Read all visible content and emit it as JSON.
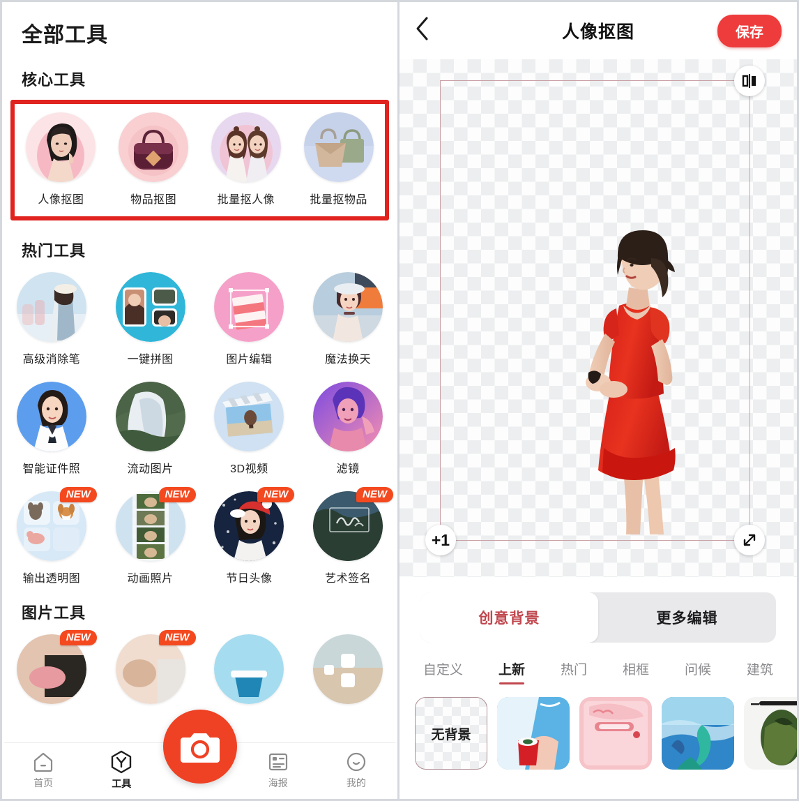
{
  "left": {
    "page_title": "全部工具",
    "sections": [
      {
        "id": "core",
        "title": "核心工具",
        "highlighted": true,
        "highlight_color": "#e0231e",
        "items": [
          {
            "label": "人像抠图",
            "icon": "portrait-cutout-icon",
            "badge": ""
          },
          {
            "label": "物品抠图",
            "icon": "object-cutout-icon",
            "badge": ""
          },
          {
            "label": "批量抠人像",
            "icon": "batch-portrait-cutout-icon",
            "badge": ""
          },
          {
            "label": "批量抠物品",
            "icon": "batch-object-cutout-icon",
            "badge": ""
          }
        ]
      },
      {
        "id": "hot",
        "title": "热门工具",
        "highlighted": false,
        "rows": [
          [
            {
              "label": "高级消除笔",
              "icon": "advanced-eraser-icon",
              "badge": ""
            },
            {
              "label": "一键拼图",
              "icon": "one-click-collage-icon",
              "badge": ""
            },
            {
              "label": "图片编辑",
              "icon": "photo-edit-icon",
              "badge": ""
            },
            {
              "label": "魔法换天",
              "icon": "magic-sky-icon",
              "badge": ""
            }
          ],
          [
            {
              "label": "智能证件照",
              "icon": "id-photo-icon",
              "badge": ""
            },
            {
              "label": "流动图片",
              "icon": "motion-photo-icon",
              "badge": ""
            },
            {
              "label": "3D视频",
              "icon": "3d-video-icon",
              "badge": ""
            },
            {
              "label": "滤镜",
              "icon": "filter-icon",
              "badge": ""
            }
          ],
          [
            {
              "label": "输出透明图",
              "icon": "transparent-output-icon",
              "badge": "NEW"
            },
            {
              "label": "动画照片",
              "icon": "animated-photo-icon",
              "badge": "NEW"
            },
            {
              "label": "节日头像",
              "icon": "holiday-avatar-icon",
              "badge": "NEW"
            },
            {
              "label": "艺术签名",
              "icon": "art-signature-icon",
              "badge": "NEW"
            }
          ]
        ]
      },
      {
        "id": "image",
        "title": "图片工具",
        "highlighted": false,
        "rows": [
          [
            {
              "label": "",
              "icon": "image-tool-1-icon",
              "badge": "NEW"
            },
            {
              "label": "",
              "icon": "image-tool-2-icon",
              "badge": "NEW"
            },
            {
              "label": "",
              "icon": "image-tool-3-icon",
              "badge": ""
            },
            {
              "label": "",
              "icon": "image-tool-4-icon",
              "badge": ""
            }
          ]
        ]
      }
    ],
    "bottom_nav": {
      "camera_icon": "camera-icon",
      "camera_color": "#ef4124",
      "items": [
        {
          "label": "首页",
          "icon": "home-icon",
          "active": false
        },
        {
          "label": "工具",
          "icon": "tools-icon",
          "active": true
        },
        {
          "label": "海报",
          "icon": "poster-icon",
          "active": false
        },
        {
          "label": "我的",
          "icon": "profile-icon",
          "active": false
        }
      ]
    }
  },
  "right": {
    "header": {
      "back_icon": "back-chevron-icon",
      "title": "人像抠图",
      "save_label": "保存",
      "save_color": "#ee3b3b"
    },
    "canvas": {
      "background": "transparent-checkerboard",
      "frame_color": "#c9a0a6",
      "handles": {
        "flip": "mirror-flip-icon",
        "add_count": "+1",
        "scale": "resize-diagonal-icon"
      },
      "subject_alt": "woman-in-red-dress-cutout"
    },
    "segmented_tabs": [
      {
        "label": "创意背景",
        "active": true
      },
      {
        "label": "更多编辑",
        "active": false
      }
    ],
    "category_tabs": [
      {
        "label": "自定义",
        "active": false
      },
      {
        "label": "上新",
        "active": true
      },
      {
        "label": "热门",
        "active": false
      },
      {
        "label": "相框",
        "active": false
      },
      {
        "label": "问候",
        "active": false
      },
      {
        "label": "建筑",
        "active": false
      }
    ],
    "background_thumbs": [
      {
        "label": "无背景",
        "type": "none",
        "selected": true
      },
      {
        "label": "",
        "type": "image",
        "selected": false
      },
      {
        "label": "",
        "type": "image",
        "selected": false
      },
      {
        "label": "",
        "type": "image",
        "selected": false
      },
      {
        "label": "",
        "type": "image",
        "selected": false
      },
      {
        "label": "",
        "type": "image",
        "selected": false
      }
    ]
  }
}
